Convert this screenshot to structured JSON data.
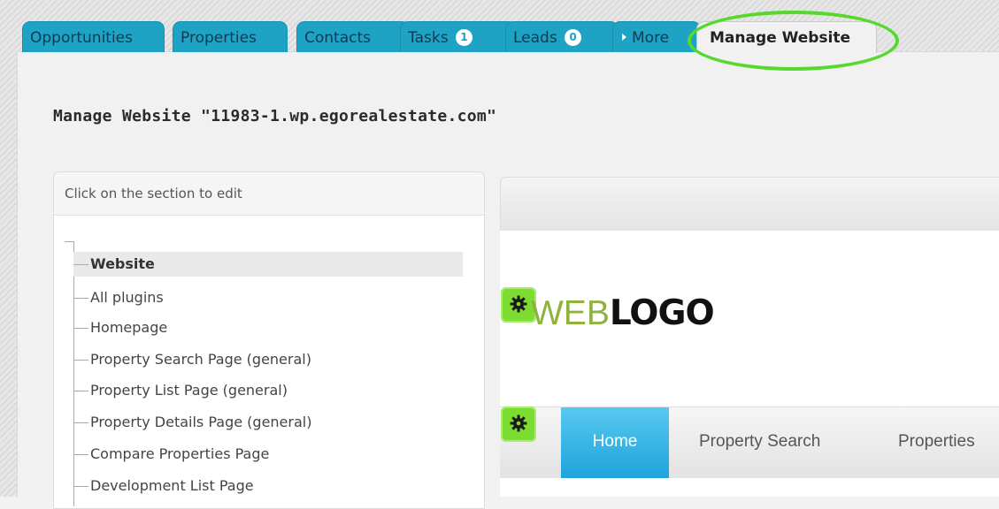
{
  "tabs": [
    {
      "label": "Opportunities"
    },
    {
      "label": "Properties"
    },
    {
      "label": "Contacts"
    },
    {
      "label": "Tasks",
      "count": "1"
    },
    {
      "label": "Leads",
      "count": "0"
    },
    {
      "label": "More"
    },
    {
      "label": "Manage Website",
      "active": true
    }
  ],
  "page": {
    "title": "Manage Website \"11983-1.wp.egorealestate.com\""
  },
  "tree": {
    "header": "Click on the section to edit",
    "items": [
      {
        "label": "Website",
        "selected": true
      },
      {
        "label": "All plugins"
      },
      {
        "label": "Homepage"
      },
      {
        "label": "Property Search Page (general)"
      },
      {
        "label": "Property List Page (general)"
      },
      {
        "label": "Property Details Page (general)"
      },
      {
        "label": "Compare Properties Page"
      },
      {
        "label": "Development List Page"
      }
    ]
  },
  "preview": {
    "logo_part1": "WEB",
    "logo_part2": "LOGO",
    "nav": [
      {
        "label": "Home",
        "active": true
      },
      {
        "label": "Property Search"
      },
      {
        "label": "Properties"
      }
    ]
  },
  "colors": {
    "tab_blue": "#1fa3c5",
    "highlight_green": "#55d92b",
    "gear_green": "#7ddc32",
    "nav_active_blue": "#1ea3dc",
    "logo_green": "#8fb33a"
  },
  "icons": {
    "more_tab": "triangle-right-icon",
    "edit_logo": "gear-icon",
    "edit_nav": "gear-icon"
  }
}
